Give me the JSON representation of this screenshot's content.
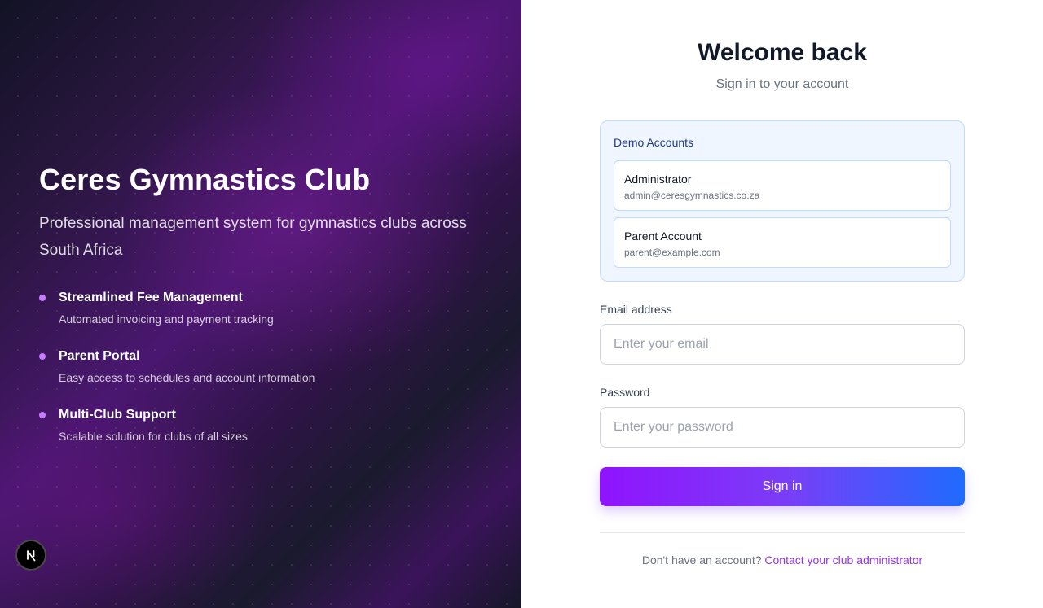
{
  "brand": {
    "title": "Ceres Gymnastics Club",
    "subtitle": "Professional management system for gymnastics clubs across South Africa",
    "features": [
      {
        "title": "Streamlined Fee Management",
        "description": "Automated invoicing and payment tracking"
      },
      {
        "title": "Parent Portal",
        "description": "Easy access to schedules and account information"
      },
      {
        "title": "Multi-Club Support",
        "description": "Scalable solution for clubs of all sizes"
      }
    ],
    "badge_letter": "N",
    "badge_icon": "next-n-icon"
  },
  "login": {
    "title": "Welcome back",
    "subtitle": "Sign in to your account",
    "demo": {
      "heading": "Demo Accounts",
      "accounts": [
        {
          "role": "Administrator",
          "email": "admin@ceresgymnastics.co.za"
        },
        {
          "role": "Parent Account",
          "email": "parent@example.com"
        }
      ]
    },
    "email": {
      "label": "Email address",
      "placeholder": "Enter your email",
      "value": ""
    },
    "password": {
      "label": "Password",
      "placeholder": "Enter your password",
      "value": ""
    },
    "submit_label": "Sign in",
    "footer_prompt": "Don't have an account?",
    "footer_link": "Contact your club administrator"
  },
  "colors": {
    "accent_purple": "#9013fe",
    "accent_blue": "#1f6bff",
    "bullet": "#c77dff",
    "link": "#9333ea",
    "demo_bg": "#eff6ff"
  }
}
